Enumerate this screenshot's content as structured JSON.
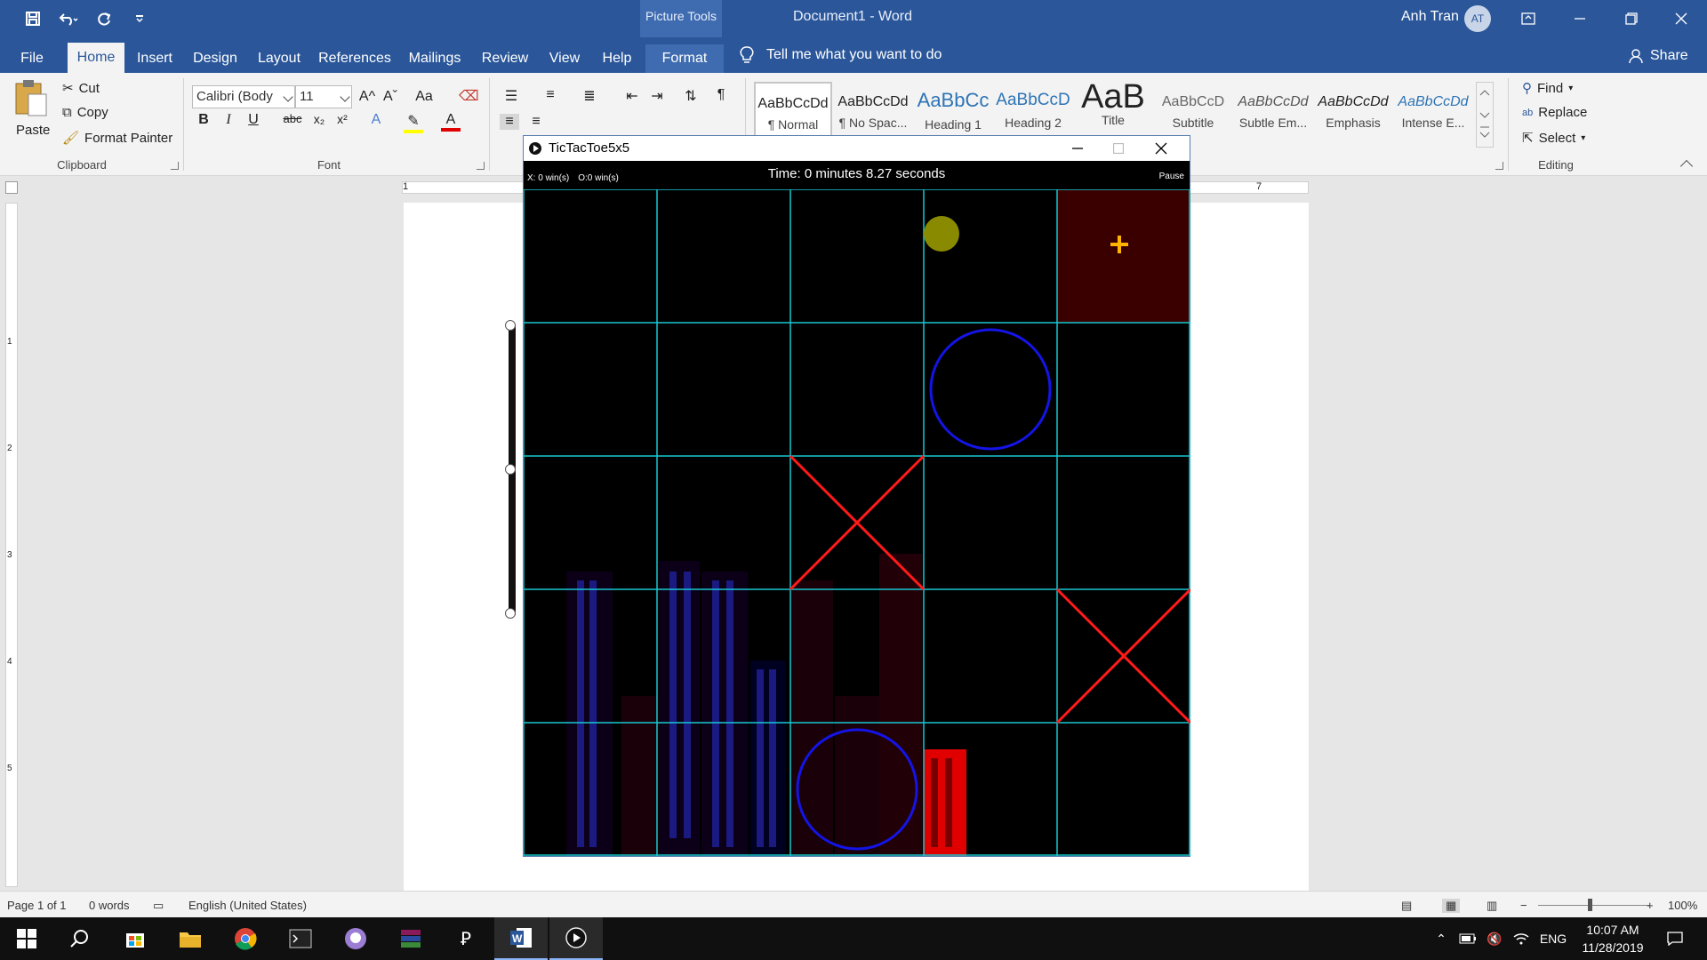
{
  "titlebar": {
    "context_label": "Picture Tools",
    "doc_title": "Document1  -  Word",
    "user_name": "Anh Tran",
    "user_initials": "AT"
  },
  "tabs": [
    "File",
    "Home",
    "Insert",
    "Design",
    "Layout",
    "References",
    "Mailings",
    "Review",
    "View",
    "Help",
    "Format"
  ],
  "active_tab": "Home",
  "tell_me": "Tell me what you want to do",
  "share_label": "Share",
  "clipboard": {
    "paste": "Paste",
    "cut": "Cut",
    "copy": "Copy",
    "format_painter": "Format Painter",
    "group_label": "Clipboard"
  },
  "font": {
    "name": "Calibri (Body",
    "size": "11",
    "group_label": "Font",
    "bold": "B",
    "italic": "I",
    "underline": "U",
    "strike": "abc",
    "subscript": "x₂",
    "superscript": "x²",
    "grow": "A^",
    "shrink": "Aˇ",
    "case": "Aa"
  },
  "styles": [
    {
      "sample": "AaBbCcDd",
      "name": "¶ Normal"
    },
    {
      "sample": "AaBbCcDd",
      "name": "¶ No Spac..."
    },
    {
      "sample": "AaBbCc",
      "name": "Heading 1"
    },
    {
      "sample": "AaBbCcD",
      "name": "Heading 2"
    },
    {
      "sample": "AaB",
      "name": "Title"
    },
    {
      "sample": "AaBbCcD",
      "name": "Subtitle"
    },
    {
      "sample": "AaBbCcDd",
      "name": "Subtle Em..."
    },
    {
      "sample": "AaBbCcDd",
      "name": "Emphasis"
    },
    {
      "sample": "AaBbCcDd",
      "name": "Intense E..."
    }
  ],
  "editing": {
    "find": "Find",
    "replace": "Replace",
    "select": "Select",
    "group_label": "Editing"
  },
  "ruler": {
    "h_left": "1",
    "h_right": "7",
    "v_marks": [
      "1",
      "2",
      "3",
      "4",
      "5"
    ]
  },
  "game": {
    "window_title": "TicTacToe5x5",
    "x_score": "X: 0 win(s)",
    "o_score": "O:0 win(s)",
    "time": "Time: 0 minutes 8.27 seconds",
    "pause": "Pause",
    "board": [
      [
        "",
        "",
        "",
        "",
        ""
      ],
      [
        "",
        "",
        "",
        "O",
        ""
      ],
      [
        "",
        "",
        "X",
        "",
        ""
      ],
      [
        "",
        "",
        "",
        "",
        "X"
      ],
      [
        "",
        "",
        "O",
        "",
        ""
      ]
    ],
    "highlight_cell": [
      0,
      4
    ],
    "colors": {
      "grid": "#17c7d1",
      "x": "#ff1a1a",
      "o": "#1414e6",
      "highlight": "#3a0000",
      "cursor": "#ffb400",
      "token": "#8a8a00"
    }
  },
  "status": {
    "page": "Page 1 of 1",
    "words": "0 words",
    "language": "English (United States)",
    "zoom": "100%"
  },
  "taskbar": {
    "lang": "ENG",
    "time": "10:07 AM",
    "date": "11/28/2019"
  }
}
